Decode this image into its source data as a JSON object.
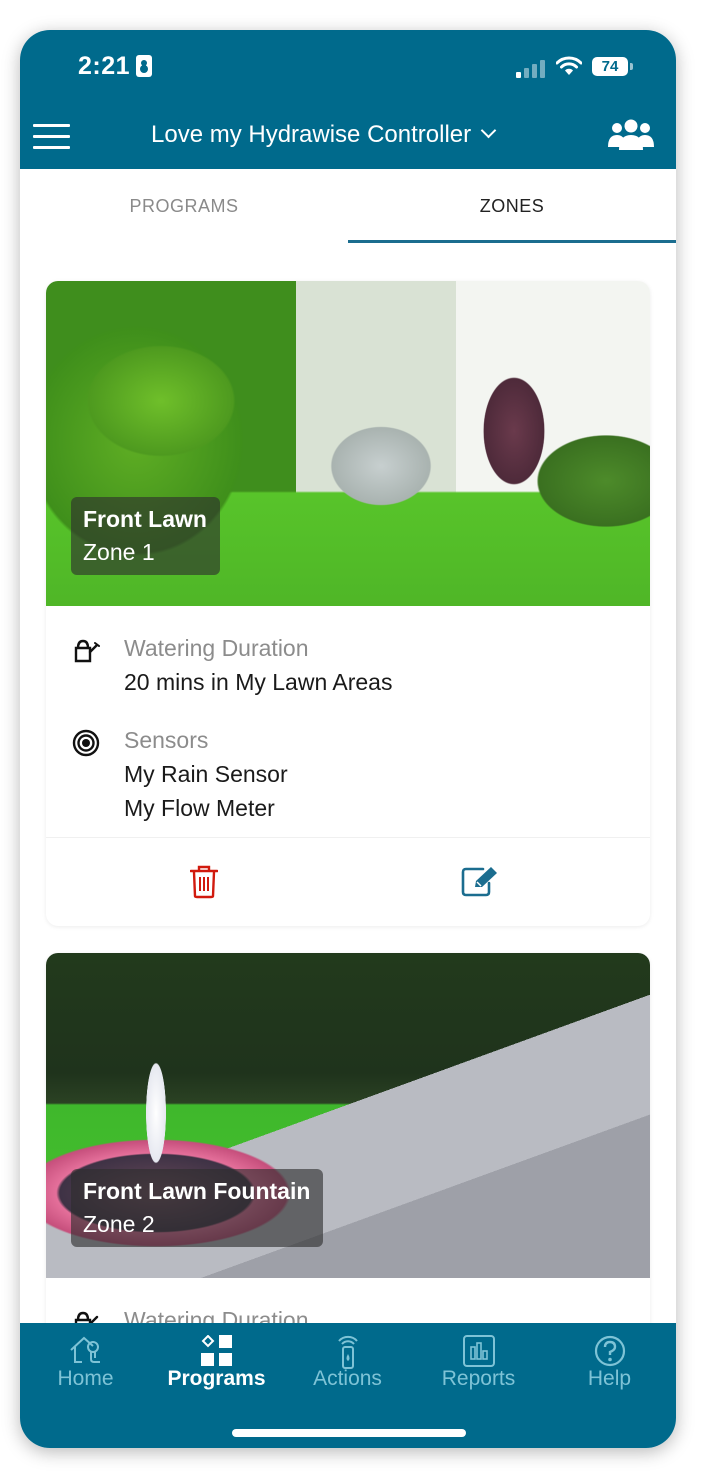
{
  "status_bar": {
    "time": "2:21",
    "battery": "74"
  },
  "header": {
    "title": "Love my Hydrawise Controller",
    "menu_icon": "hamburger-menu-icon",
    "dropdown_icon": "chevron-down-icon",
    "users_icon": "users-group-icon"
  },
  "tabs": [
    {
      "label": "PROGRAMS",
      "active": false
    },
    {
      "label": "ZONES",
      "active": true
    }
  ],
  "zones": [
    {
      "name": "Front Lawn",
      "zone": "Zone 1",
      "watering_label": "Watering Duration",
      "watering_value": "20 mins in My Lawn Areas",
      "sensors_label": "Sensors",
      "sensors": [
        "My Rain Sensor",
        "My Flow Meter"
      ],
      "delete_icon": "trash-icon",
      "edit_icon": "edit-icon"
    },
    {
      "name": "Front Lawn Fountain",
      "zone": "Zone 2",
      "watering_label": "Watering Duration"
    }
  ],
  "colors": {
    "primary": "#006a8c",
    "delete": "#d11a0e",
    "edit": "#1b6d8f",
    "nav_inactive": "#7ec3d6"
  },
  "bottom_nav": [
    {
      "label": "Home",
      "icon": "home-icon",
      "active": false
    },
    {
      "label": "Programs",
      "icon": "programs-icon",
      "active": true
    },
    {
      "label": "Actions",
      "icon": "actions-icon",
      "active": false
    },
    {
      "label": "Reports",
      "icon": "reports-icon",
      "active": false
    },
    {
      "label": "Help",
      "icon": "help-icon",
      "active": false
    }
  ]
}
